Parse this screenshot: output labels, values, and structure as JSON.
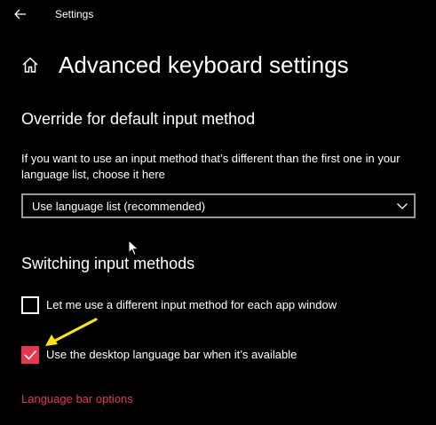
{
  "window": {
    "title": "Settings",
    "back_icon": "back-arrow-icon"
  },
  "page": {
    "title": "Advanced keyboard settings",
    "home_icon": "home-icon"
  },
  "override_section": {
    "heading": "Override for default input method",
    "description": "If you want to use an input method that’s different than the first one in your language list, choose it here",
    "dropdown": {
      "selected": "Use language list (recommended)",
      "chevron_icon": "chevron-down-icon"
    }
  },
  "switching_section": {
    "heading": "Switching input methods",
    "checkboxes": [
      {
        "label": "Let me use a different input method for each app window",
        "checked": false
      },
      {
        "label": "Use the desktop language bar when it’s available",
        "checked": true
      }
    ]
  },
  "links": {
    "language_bar_options": "Language bar options"
  },
  "colors": {
    "background": "#000000",
    "text": "#ffffff",
    "accent": "#e5374d",
    "annotation": "#ffe600",
    "dropdown_border": "#999999"
  }
}
